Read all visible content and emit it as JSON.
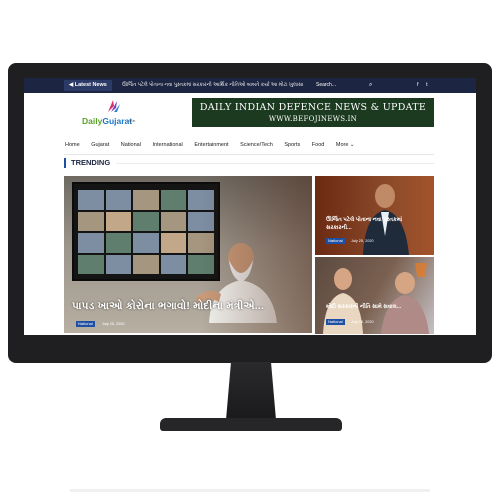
{
  "topbar": {
    "latest_label": "Latest News",
    "ticker": "ઊર્જિત પટેલે પોતાના નવા પુસ્તકમાં સરકારની આર્થિક નીતિઓ બાબતે કર્યા આ મોટા ખુલાસા",
    "search_placeholder": "Search...",
    "social": [
      "f",
      "t"
    ]
  },
  "site": {
    "logo_daily": "Daily",
    "logo_gujarat": "Gujarat",
    "logo_domain": ".co.in"
  },
  "banner": {
    "title": "DAILY INDIAN DEFENCE NEWS & UPDATE",
    "url": "WWW.BEFOJINEWS.IN"
  },
  "nav": {
    "items": [
      "Home",
      "Gujarat",
      "National",
      "International",
      "Entertainment",
      "Science/Tech",
      "Sports",
      "Food"
    ],
    "more": "More ⌄"
  },
  "section": {
    "title": "TRENDING"
  },
  "main_story": {
    "title": "પાપડ ખાઓ કોરોના ભગાવો! મોદીના મંત્રીએ...",
    "category": "National",
    "date": "July 25, 2020"
  },
  "side_stories": [
    {
      "title": "ઊર્જિત પટેલે પોતાના નવા પુસ્તકમાં સરકારની...",
      "category": "National",
      "date": "July 25, 2020"
    },
    {
      "title": "મોદી સરકારની નીતિ સામે સવાલ...",
      "category": "National",
      "date": "July 25, 2020"
    }
  ],
  "colors": {
    "topbar": "#1c2541",
    "accent": "#1e4fa3",
    "banner": "#1b3a20",
    "logo_green": "#5aa02c",
    "logo_blue": "#1e78c8"
  }
}
